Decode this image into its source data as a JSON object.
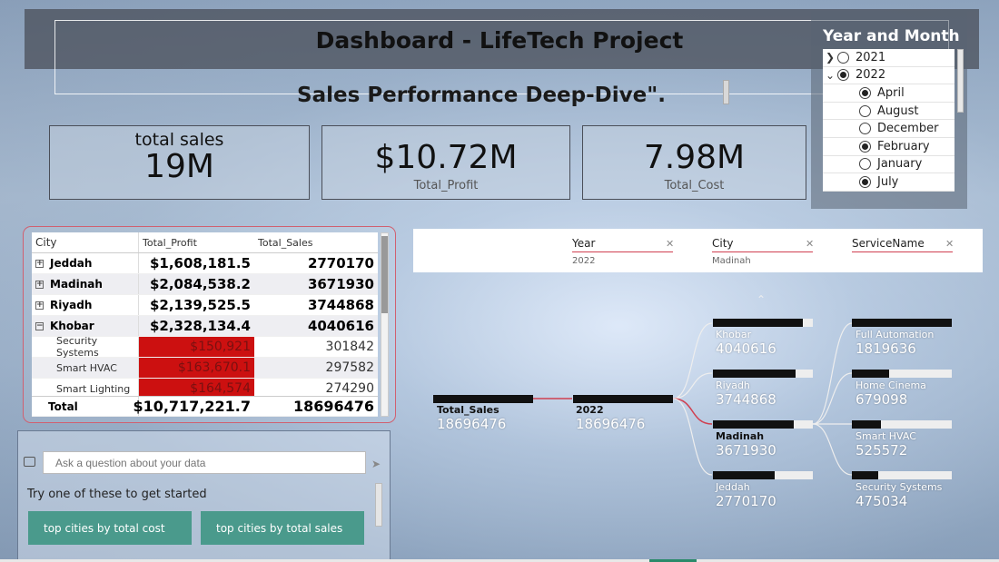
{
  "header": {
    "title": "Dashboard - LifeTech Project",
    "subtitle": "Sales Performance Deep-Dive\"."
  },
  "kpis": {
    "total_sales": {
      "label": "total sales",
      "value": "19M"
    },
    "total_profit": {
      "label": "Total_Profit",
      "value": "$10.72M"
    },
    "total_cost": {
      "label": "Total_Cost",
      "value": "7.98M"
    }
  },
  "slicer": {
    "title": "Year and Month",
    "items": [
      {
        "label": "2021",
        "level": 0,
        "expanded": false,
        "selected": false
      },
      {
        "label": "2022",
        "level": 0,
        "expanded": true,
        "selected": true
      },
      {
        "label": "April",
        "level": 1,
        "selected": true
      },
      {
        "label": "August",
        "level": 1,
        "selected": false
      },
      {
        "label": "December",
        "level": 1,
        "selected": false
      },
      {
        "label": "February",
        "level": 1,
        "selected": true
      },
      {
        "label": "January",
        "level": 1,
        "selected": false
      },
      {
        "label": "July",
        "level": 1,
        "selected": true
      }
    ]
  },
  "matrix": {
    "columns": [
      "City",
      "Total_Profit",
      "Total_Sales"
    ],
    "rows": [
      {
        "city": "Jeddah",
        "profit": "$1,608,181.5",
        "sales": "2770170",
        "type": "parent",
        "expanded": false
      },
      {
        "city": "Madinah",
        "profit": "$2,084,538.2",
        "sales": "3671930",
        "type": "parent",
        "expanded": false
      },
      {
        "city": "Riyadh",
        "profit": "$2,139,525.5",
        "sales": "3744868",
        "type": "parent",
        "expanded": false
      },
      {
        "city": "Khobar",
        "profit": "$2,328,134.4",
        "sales": "4040616",
        "type": "parent",
        "expanded": true
      },
      {
        "city": "Security Systems",
        "profit": "$150,921",
        "sales": "301842",
        "type": "child"
      },
      {
        "city": "Smart HVAC",
        "profit": "$163,670.1",
        "sales": "297582",
        "type": "child"
      },
      {
        "city": "Smart Lighting",
        "profit": "$164,574",
        "sales": "274290",
        "type": "child"
      }
    ],
    "total": {
      "label": "Total",
      "profit": "$10,717,221.7",
      "sales": "18696476"
    }
  },
  "qna": {
    "placeholder": "Ask a question about your data",
    "prompt": "Try one of these to get started",
    "suggestions": [
      "top cities by total cost",
      "top cities by total sales"
    ]
  },
  "decomp": {
    "filters": [
      {
        "name": "Year",
        "value": "2022"
      },
      {
        "name": "City",
        "value": "Madinah"
      },
      {
        "name": "ServiceName",
        "value": ""
      }
    ],
    "root": {
      "label": "Total_Sales",
      "value": "18696476",
      "fill": 1.0
    },
    "year": {
      "label": "2022",
      "value": "18696476",
      "fill": 1.0
    },
    "cities": [
      {
        "label": "Khobar",
        "value": "4040616",
        "fill": 0.9
      },
      {
        "label": "Riyadh",
        "value": "3744868",
        "fill": 0.83
      },
      {
        "label": "Madinah",
        "value": "3671930",
        "fill": 0.81,
        "selected": true
      },
      {
        "label": "Jeddah",
        "value": "2770170",
        "fill": 0.62
      }
    ],
    "services": [
      {
        "label": "Full Automation",
        "value": "1819636",
        "fill": 1.0
      },
      {
        "label": "Home Cinema",
        "value": "679098",
        "fill": 0.37
      },
      {
        "label": "Smart HVAC",
        "value": "525572",
        "fill": 0.29
      },
      {
        "label": "Security Systems",
        "value": "475034",
        "fill": 0.26
      }
    ]
  },
  "colors": {
    "accent_teal": "#4a9a8c",
    "negative_red": "#cc1010",
    "filter_underline": "#d04050"
  }
}
